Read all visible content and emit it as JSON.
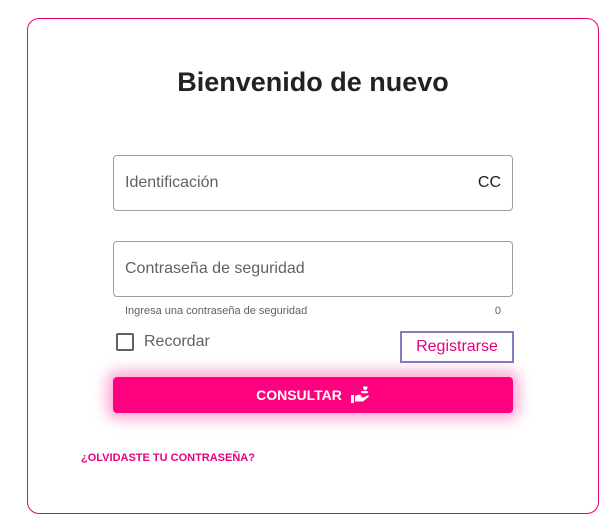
{
  "login": {
    "title": "Bienvenido de nuevo",
    "identification": {
      "placeholder": "Identificación",
      "value": "",
      "doc_type": "CC"
    },
    "password": {
      "placeholder": "Contraseña de seguridad",
      "value": "",
      "hint": "Ingresa una contraseña de seguridad",
      "counter": "0"
    },
    "remember_label": "Recordar",
    "remember_checked": false,
    "register_label": "Registrarse",
    "submit_label": "CONSULTAR",
    "submit_icon": "hand-heart-icon",
    "forgot_label": "¿OLVIDASTE TU CONTRASEÑA?"
  },
  "colors": {
    "accent": "#e6007e",
    "button": "#ff007f",
    "register_border": "#7e7dbf"
  }
}
